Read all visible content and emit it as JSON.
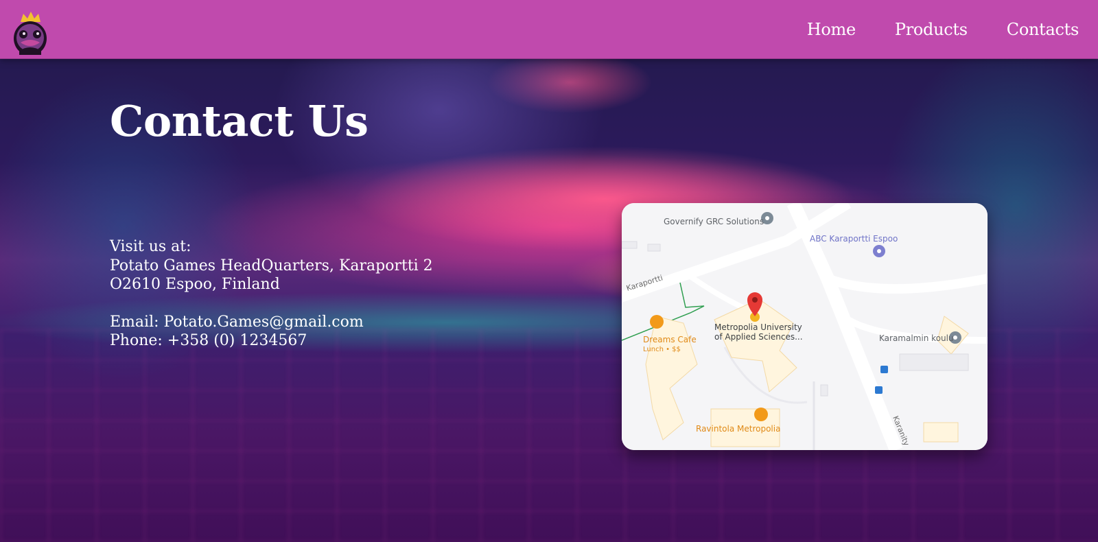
{
  "header": {
    "logo_name": "potato-games-logo",
    "nav": [
      {
        "label": "Home"
      },
      {
        "label": "Products"
      },
      {
        "label": "Contacts"
      }
    ]
  },
  "main": {
    "title": "Contact Us",
    "visit_label": "Visit us at:",
    "address_line1": "Potato Games HeadQuarters, Karaportti 2",
    "address_line2": "O2610 Espoo, Finland",
    "email_line": "Email: Potato.Games@gmail.com",
    "phone_line": "Phone: +358 (0) 1234567"
  },
  "map": {
    "places": {
      "governify": "Governify GRC Solutions",
      "abc": "ABC Karaportti Espoo",
      "karaportti_road": "Karaportti",
      "metropolia_line1": "Metropolia University",
      "metropolia_line2": "of Applied Sciences...",
      "dreams_cafe": "Dreams Cafe",
      "dreams_sub": "Lunch • $$",
      "karamalmin": "Karamalmin koulu",
      "ravintola": "Ravintola Metropolia",
      "karanity": "Karanity"
    }
  },
  "colors": {
    "header_bg": "#c04aad",
    "text": "#ffffff",
    "map_pin": "#e53935"
  }
}
